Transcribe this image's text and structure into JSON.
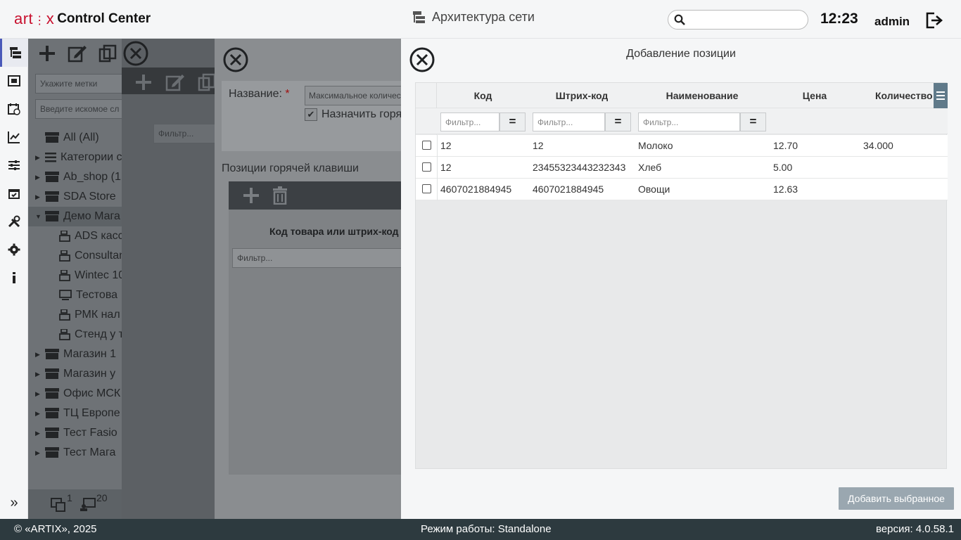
{
  "header": {
    "logo_text": "art x",
    "logo_suffix": "Control Center",
    "section_title": "Архитектура сети",
    "search_placeholder": "",
    "time": "12:23",
    "user": "admin"
  },
  "rail": {
    "icons": [
      "tree-icon",
      "store-icon",
      "schedule-icon",
      "chart-icon",
      "sliders-icon",
      "calendar-icon",
      "tools-icon",
      "gear-icon",
      "info-icon"
    ],
    "collapse": "»"
  },
  "bg_tree": {
    "tags_placeholder": "Укажите метки",
    "search_placeholder": "Введите искомое сл",
    "items": [
      {
        "label": "All (All)",
        "icon": "store-icon",
        "arrow": ""
      },
      {
        "label": "Категории с",
        "icon": "list-icon",
        "arrow": "▶"
      },
      {
        "label": "Ab_shop (1",
        "icon": "store-icon",
        "arrow": "▶"
      },
      {
        "label": "SDA Store",
        "icon": "store-icon",
        "arrow": "▶"
      },
      {
        "label": "Демо Мага",
        "icon": "store-icon",
        "arrow": "▼"
      }
    ],
    "children": [
      {
        "label": "ADS касс",
        "icon": "cash-register-icon"
      },
      {
        "label": "Consultan",
        "icon": "cash-register-icon"
      },
      {
        "label": "Wintec 10",
        "icon": "cash-register-icon"
      },
      {
        "label": "Тестова",
        "icon": "monitor-icon"
      },
      {
        "label": "РМК нал",
        "icon": "cash-register-icon"
      },
      {
        "label": "Стенд у т",
        "icon": "cash-register-icon"
      }
    ],
    "more_items": [
      {
        "label": "Магазин 1",
        "arrow": "▶"
      },
      {
        "label": "Магазин у",
        "arrow": "▶"
      },
      {
        "label": "Офис МСК",
        "arrow": "▶"
      },
      {
        "label": "ТЦ Европе",
        "arrow": "▶"
      },
      {
        "label": "Тест Fasio",
        "arrow": "▶"
      },
      {
        "label": "Тест Мага",
        "arrow": "▶"
      }
    ],
    "bottom_counts": [
      "1",
      "20"
    ]
  },
  "bg_panel_b": {
    "filter_placeholder": "Фильтр..."
  },
  "bg_panel_c": {
    "name_label": "Название:",
    "required_mark": "*",
    "name_value": "Максимальное количес",
    "checkbox_label": "Назначить горя",
    "hotkey_section": "Позиции горячей клавиши",
    "grid_header": "Код товара или штрих-код",
    "filter_placeholder": "Фильтр..."
  },
  "dialog": {
    "title": "Добавление позиции",
    "columns": [
      "Код",
      "Штрих-код",
      "Наименование",
      "Цена",
      "Количество"
    ],
    "filter_placeholder": "Фильтр...",
    "filter_op": "=",
    "rows": [
      {
        "code": "12",
        "barcode": "12",
        "name": "Молоко",
        "price": "12.70",
        "qty": "34.000"
      },
      {
        "code": "12",
        "barcode": "23455323443232343",
        "name": "Хлеб",
        "price": "5.00",
        "qty": ""
      },
      {
        "code": "4607021884945",
        "barcode": "4607021884945",
        "name": "Овощи",
        "price": "12.63",
        "qty": ""
      }
    ],
    "add_button": "Добавить выбранное"
  },
  "footer": {
    "copyright": "© «ARTIX», 2025",
    "mode": "Режим работы: Standalone",
    "version": "версия: 4.0.58.1"
  },
  "colors": {
    "brand_red": "#c8102e",
    "accent": "#4a59b9",
    "footer_bg": "#2d3a3f",
    "menu_btn": "#607a8a"
  }
}
